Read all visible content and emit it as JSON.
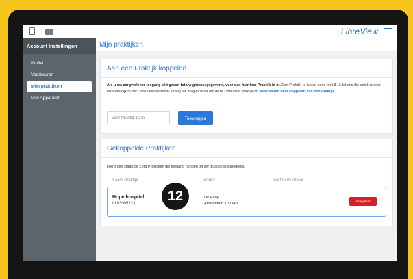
{
  "topbar": {
    "brand": "LibreView",
    "icons": [
      "device-icon",
      "folder-icon",
      "menu-icon"
    ]
  },
  "sidebar": {
    "title": "Account Instellingen",
    "items": [
      {
        "label": "Profiel",
        "active": false
      },
      {
        "label": "Voorkeuren",
        "active": false
      },
      {
        "label": "Mijn praktijken",
        "active": true
      },
      {
        "label": "Mijn Apparaten",
        "active": false
      }
    ]
  },
  "page": {
    "title": "Mijn praktijken"
  },
  "link_card": {
    "title": "Aan een Praktijk koppelen",
    "desc_bold": "Als u uw zorgverlener toegang wilt geven tot uw glucosegegevens, voer dan hier hun Praktijk-Id in.",
    "desc_text": " Een Praktijk-Id is een code met 8-16 tekens die uniek is voor elke Praktijk in het LibreView-systeem. Vraag uw zorgverlener om deze LibreView praktijk-id. ",
    "desc_link": "Meer weten over koppelen aan een Praktijk.",
    "input_placeholder": "Voer Praktijk-ID in",
    "add_button": "Toevoegen"
  },
  "linked_card": {
    "title": "Gekoppelde Praktijken",
    "desc": "Hieronder staan de Zorg Praktijken die toegang hebben tot uw glucosegeschiedenis.",
    "columns": [
      "Naam Praktijk",
      "Adres",
      "Telefoonnummer"
    ],
    "rows": [
      {
        "name": "Hope hospital",
        "id": "Id 03095223",
        "street": "De Hoop",
        "city": "Amsterdam 1000AB",
        "phone": "",
        "remove_label": "Verwijderen"
      }
    ]
  },
  "step_badge": "12",
  "colors": {
    "accent": "#2b79d6",
    "sidebar": "#5c656c",
    "danger": "#d71f26",
    "frame": "#f7c51e"
  }
}
